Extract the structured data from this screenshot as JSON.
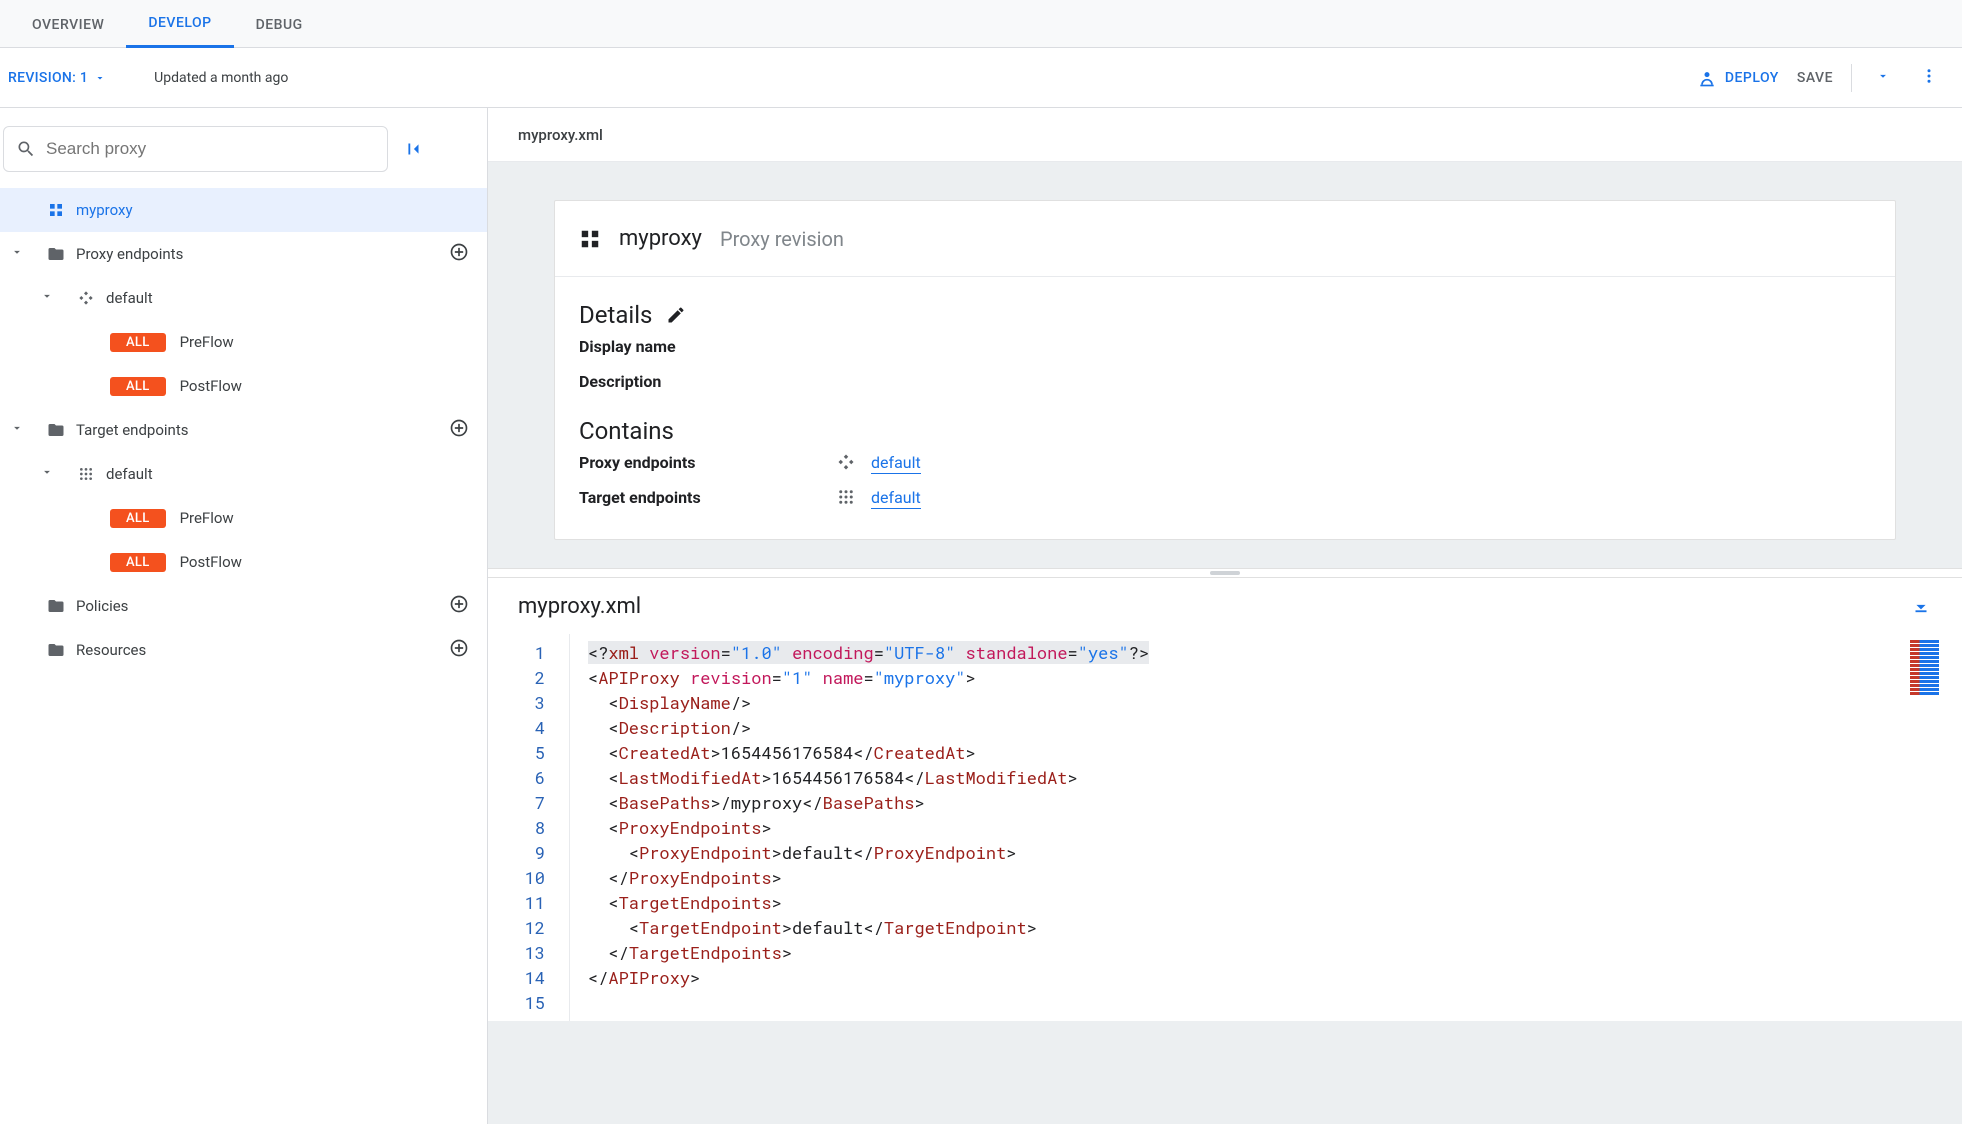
{
  "tabs": {
    "overview": "OVERVIEW",
    "develop": "DEVELOP",
    "debug": "DEBUG",
    "active": "develop"
  },
  "revision": {
    "label": "REVISION: 1",
    "updated_text": "Updated a month ago"
  },
  "toolbar": {
    "deploy": "DEPLOY",
    "save": "SAVE"
  },
  "search": {
    "placeholder": "Search proxy"
  },
  "tree": {
    "proxy_name": "myproxy",
    "proxy_endpoints_label": "Proxy endpoints",
    "proxy_default_label": "default",
    "proxy_preflow_label": "PreFlow",
    "proxy_postflow_label": "PostFlow",
    "target_endpoints_label": "Target endpoints",
    "target_default_label": "default",
    "target_preflow_label": "PreFlow",
    "target_postflow_label": "PostFlow",
    "policies_label": "Policies",
    "resources_label": "Resources",
    "verb_all": "ALL"
  },
  "content": {
    "crumb": "myproxy.xml",
    "card": {
      "title": "myproxy",
      "subtitle": "Proxy revision",
      "details_heading": "Details",
      "display_name_label": "Display name",
      "description_label": "Description",
      "contains_heading": "Contains",
      "proxy_ep_label": "Proxy endpoints",
      "proxy_ep_link": "default",
      "target_ep_label": "Target endpoints",
      "target_ep_link": "default"
    },
    "code_title": "myproxy.xml",
    "code": {
      "xml_decl_version": "\"1.0\"",
      "xml_decl_encoding": "\"UTF-8\"",
      "xml_decl_standalone": "\"yes\"",
      "apiproxy_revision": "\"1\"",
      "apiproxy_name": "\"myproxy\"",
      "created_at": "1654456176584",
      "last_modified_at": "1654456176584",
      "base_paths": "/myproxy",
      "proxy_endpoint_val": "default",
      "target_endpoint_val": "default"
    }
  }
}
